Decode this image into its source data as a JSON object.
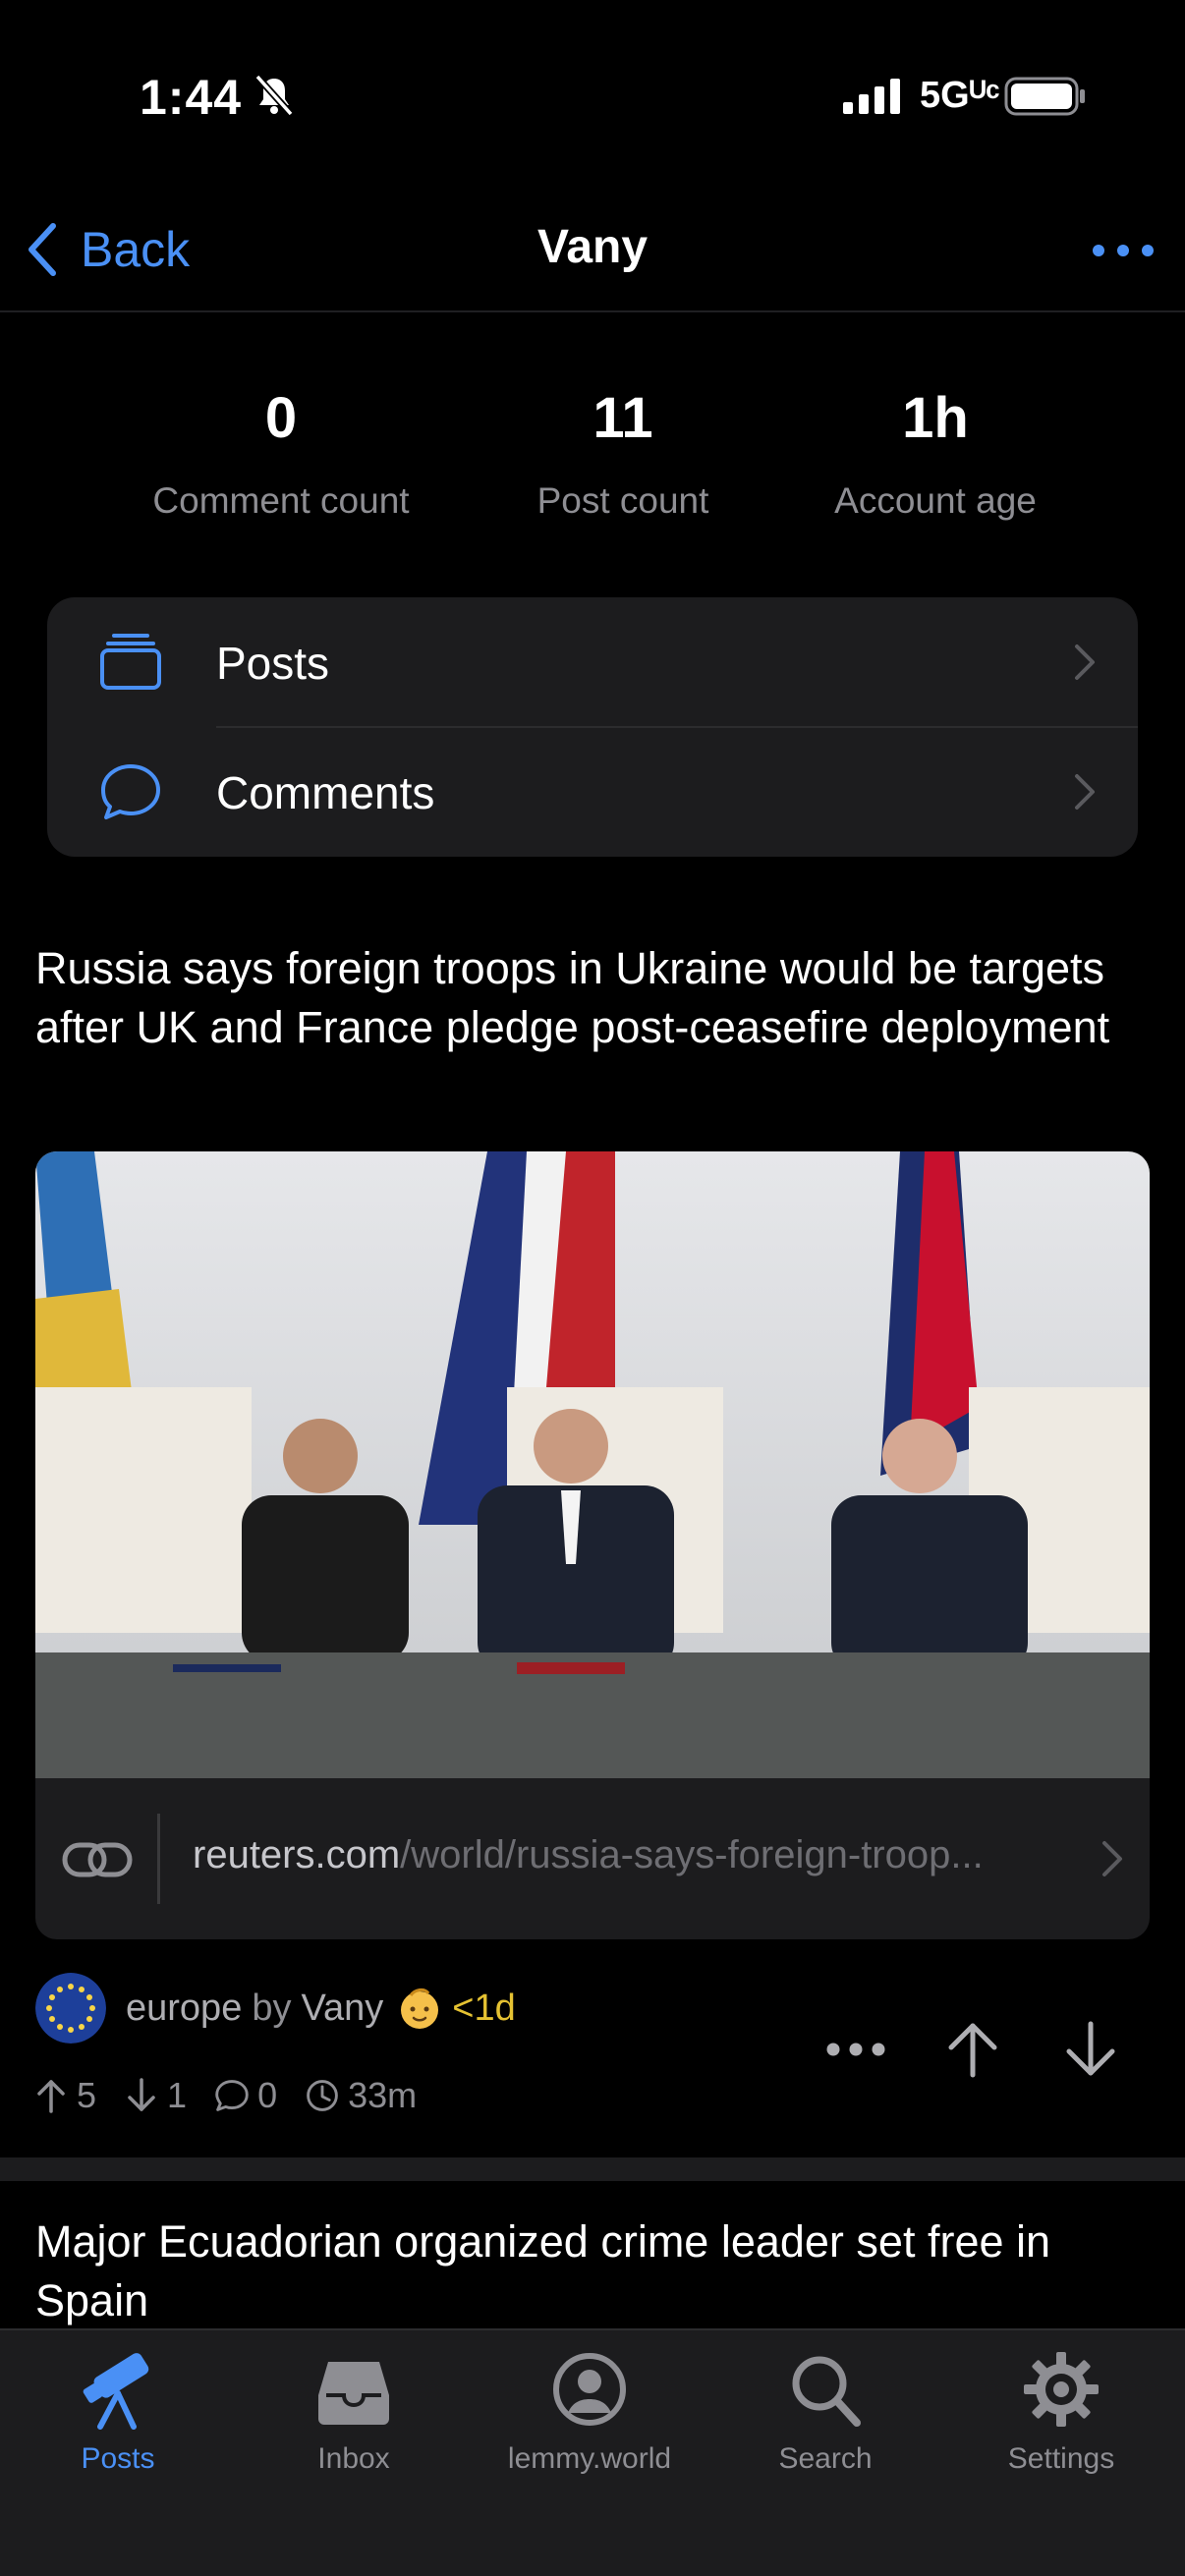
{
  "status_bar": {
    "time": "1:44",
    "network": "5Gᵁᶜ",
    "icons": [
      "bell-slash-icon",
      "signal-icon",
      "battery-icon"
    ]
  },
  "nav": {
    "back_label": "Back",
    "title": "Vany",
    "more_icon": "ellipsis-icon"
  },
  "stats": [
    {
      "value": "0",
      "label": "Comment count"
    },
    {
      "value": "11",
      "label": "Post count"
    },
    {
      "value": "1h",
      "label": "Account age"
    }
  ],
  "menu": [
    {
      "label": "Posts",
      "icon": "stack-icon"
    },
    {
      "label": "Comments",
      "icon": "speech-bubble-icon"
    }
  ],
  "post": {
    "title": "Russia says foreign troops in Ukraine would be targets after UK and France pledge post-ceasefire deployment",
    "link_domain": "reuters.com",
    "link_path": "/world/russia-says-foreign-troop...",
    "community": "europe",
    "by": "by",
    "author": "Vany",
    "age": "<1d",
    "upvotes": "5",
    "downvotes": "1",
    "comments": "0",
    "time": "33m"
  },
  "next_post": {
    "title": "Major Ecuadorian organized crime leader set free in Spain"
  },
  "tabs": [
    {
      "label": "Posts",
      "icon": "telescope-icon",
      "active": true
    },
    {
      "label": "Inbox",
      "icon": "inbox-tray-icon",
      "active": false
    },
    {
      "label": "lemmy.world",
      "icon": "person-circle-icon",
      "active": false
    },
    {
      "label": "Search",
      "icon": "magnifier-icon",
      "active": false
    },
    {
      "label": "Settings",
      "icon": "gear-icon",
      "active": false
    }
  ],
  "colors": {
    "accent": "#4a90f5",
    "background": "#000000",
    "card": "#1c1c1e",
    "secondary_text": "#8e8e93",
    "age_badge": "#e5c232"
  }
}
